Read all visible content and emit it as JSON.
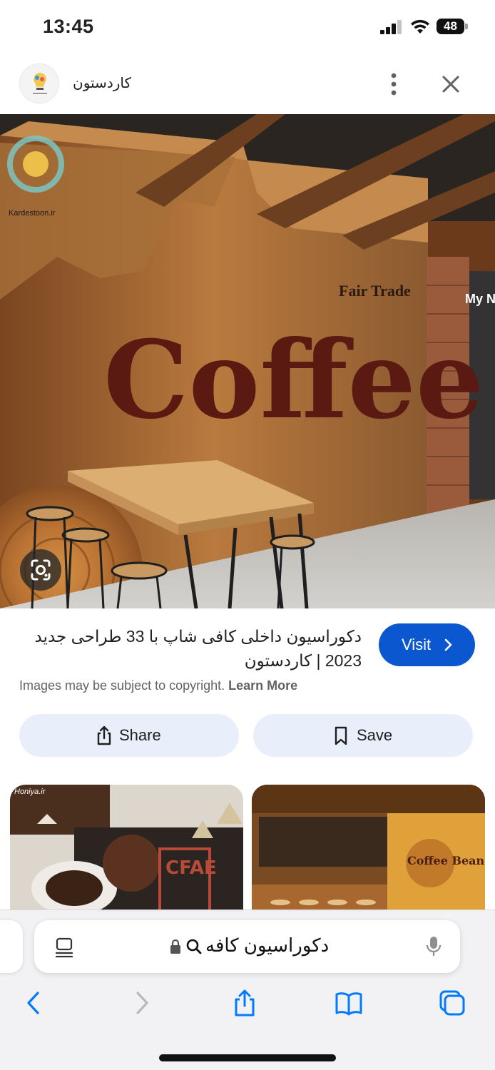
{
  "status_bar": {
    "time": "13:45",
    "battery": "48"
  },
  "header": {
    "site_name": "کاردستون",
    "more_icon": "more-vertical-icon",
    "close_icon": "close-icon"
  },
  "main_image": {
    "description_icon": "lens-icon",
    "watermark_text": "Kardestoon.ir",
    "wall_text": "Coffee",
    "sign_text": "Fair Trade",
    "store_sign": "My No"
  },
  "result": {
    "title": "دکوراسیون داخلی کافی شاپ با 33 طراحی جدید 2023 | کاردستون",
    "visit_label": "Visit",
    "copyright_text": "Images may be subject to copyright.",
    "learn_more": "Learn More",
    "share_label": "Share",
    "save_label": "Save"
  },
  "related": {
    "thumb1_watermark": "Honiya.ir",
    "thumb1_sign": "CFAE",
    "thumb2_sign": "Coffee Bean"
  },
  "browser": {
    "address_text": "دکوراسیون کافه",
    "accent": "#0b57d0",
    "ios_blue": "#007aff"
  }
}
